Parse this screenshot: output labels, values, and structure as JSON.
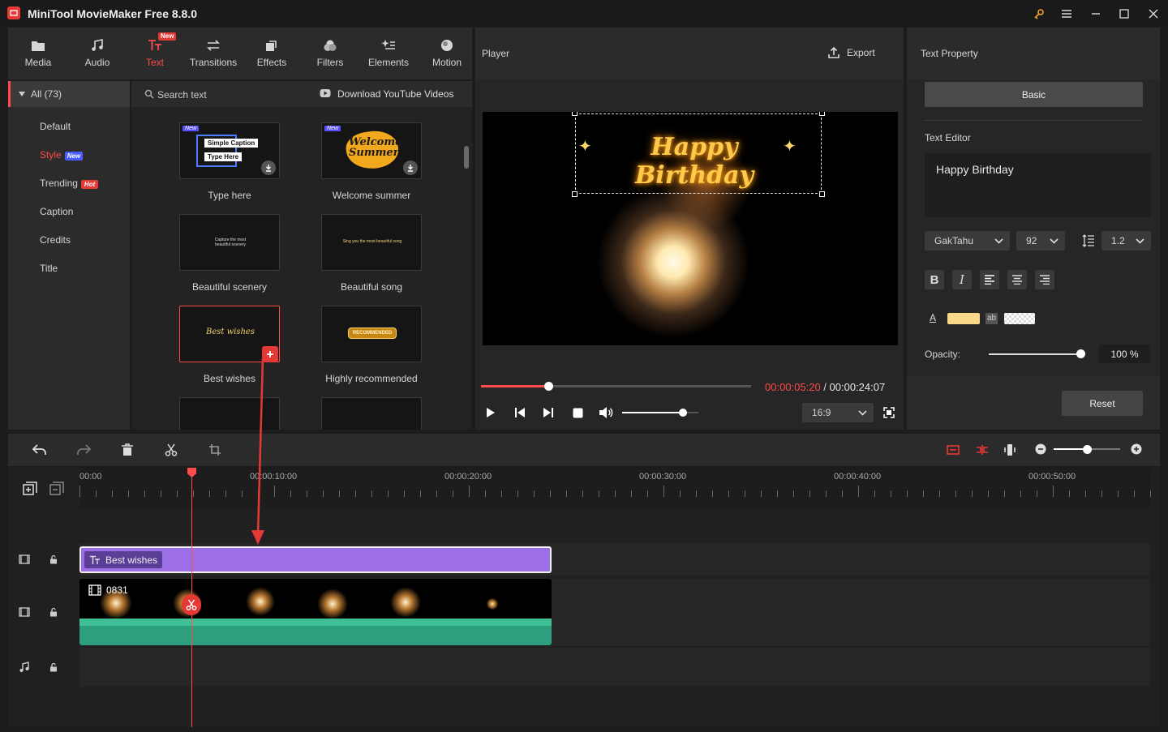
{
  "app": {
    "title": "MiniTool MovieMaker Free 8.8.0"
  },
  "tabs": [
    {
      "label": "Media",
      "icon": "folder-icon"
    },
    {
      "label": "Audio",
      "icon": "music-note-icon"
    },
    {
      "label": "Text",
      "icon": "text-icon",
      "badge": "New"
    },
    {
      "label": "Transitions",
      "icon": "transitions-icon"
    },
    {
      "label": "Effects",
      "icon": "effects-icon"
    },
    {
      "label": "Filters",
      "icon": "filters-icon"
    },
    {
      "label": "Elements",
      "icon": "elements-icon"
    },
    {
      "label": "Motion",
      "icon": "motion-icon"
    }
  ],
  "categories": {
    "all": "All (73)",
    "items": [
      "Default",
      "Style",
      "Trending",
      "Caption",
      "Credits",
      "Title"
    ],
    "style_badge": "New",
    "trending_badge": "Hot"
  },
  "library": {
    "search_placeholder": "Search text",
    "download_label": "Download YouTube Videos",
    "cards": [
      {
        "label": "Type here",
        "preview_line1": "Simple Caption",
        "preview_line2": "Type Here",
        "tag": "New"
      },
      {
        "label": "Welcome summer",
        "preview_line1": "Welcome",
        "preview_line2": "Summer",
        "tag": "New"
      },
      {
        "label": "Beautiful scenery",
        "preview_line1": "Capture the most",
        "preview_line2": "beautiful scenery"
      },
      {
        "label": "Beautiful song",
        "preview_line1": "Sing you the most beautiful song"
      },
      {
        "label": "Best wishes",
        "preview_line1": "Best wishes"
      },
      {
        "label": "Highly recommended",
        "preview_line1": "RECOMMENDED"
      }
    ]
  },
  "player": {
    "title": "Player",
    "export_label": "Export",
    "overlay_text": "Happy Birthday",
    "current_time": "00:00:05:20",
    "separator": " / ",
    "total_time": "00:00:24:07",
    "aspect": "16:9",
    "progress": 0.25,
    "volume": 0.8
  },
  "properties": {
    "title": "Text Property",
    "basic_tab": "Basic",
    "editor_label": "Text Editor",
    "editor_value": "Happy Birthday",
    "font": "GakTahu",
    "size": "92",
    "line_spacing": "1.2",
    "bold": "B",
    "italic": "I",
    "font_color_letter": "A",
    "bg_letters": "ab",
    "font_color": "#f9d98a",
    "opacity_label": "Opacity:",
    "opacity_value": "100 %",
    "opacity": 1.0,
    "reset_label": "Reset"
  },
  "timeline": {
    "ruler_labels": [
      "00:00",
      "00:00:10:00",
      "00:00:20:00",
      "00:00:30:00",
      "00:00:40:00",
      "00:00:50:00"
    ],
    "text_clip_label": "Best wishes",
    "video_clip_label": "0831",
    "zoom": 0.5
  },
  "colors": {
    "accent": "#ff4b4b",
    "text_clip": "#9d6fe6",
    "video_strip": "#2e9f7e"
  }
}
